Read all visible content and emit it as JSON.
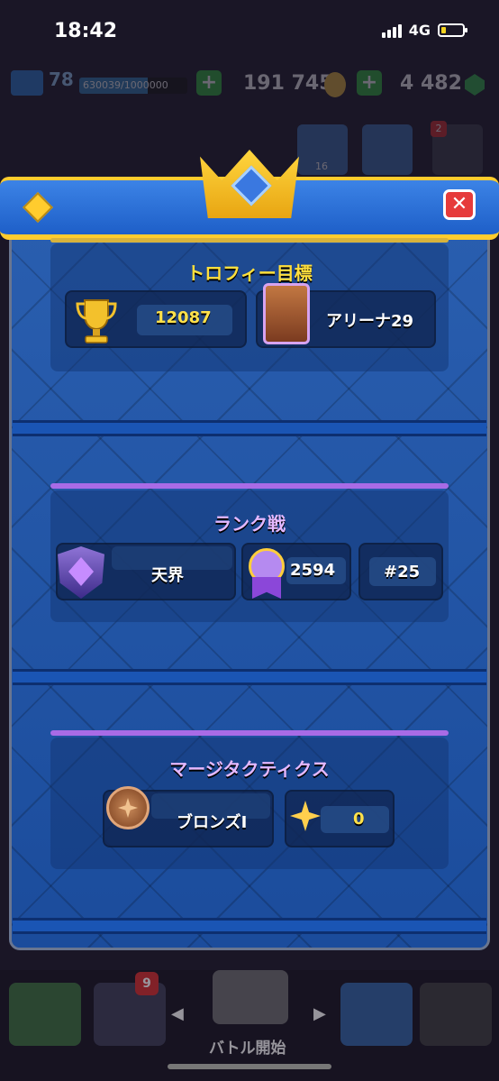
{
  "status_bar": {
    "time": "18:42",
    "network": "4G"
  },
  "background_topbar": {
    "level": "78",
    "xp_text": "630039/1000000",
    "xp_progress": 0.63,
    "gold": "191 745",
    "gems": "4 482",
    "friends_count": "16",
    "menu_badge": "2"
  },
  "dialog": {
    "trophy_section": {
      "title": "トロフィー目標",
      "trophies": "12087",
      "arena": "アリーナ29"
    },
    "ranked_section": {
      "title": "ランク戦",
      "league": "天界",
      "rating": "2594",
      "position": "#25"
    },
    "merge_section": {
      "title": "マージタクティクス",
      "league": "ブロンズI",
      "points": "0"
    }
  },
  "bottom_nav": {
    "cards_badge": "9",
    "battle_label": "バトル開始"
  },
  "colors": {
    "accent_gold": "#ffcc2e",
    "dialog_blue": "#1f4f9c",
    "purple_line": "#a86be6",
    "close_red": "#e63b3b"
  }
}
